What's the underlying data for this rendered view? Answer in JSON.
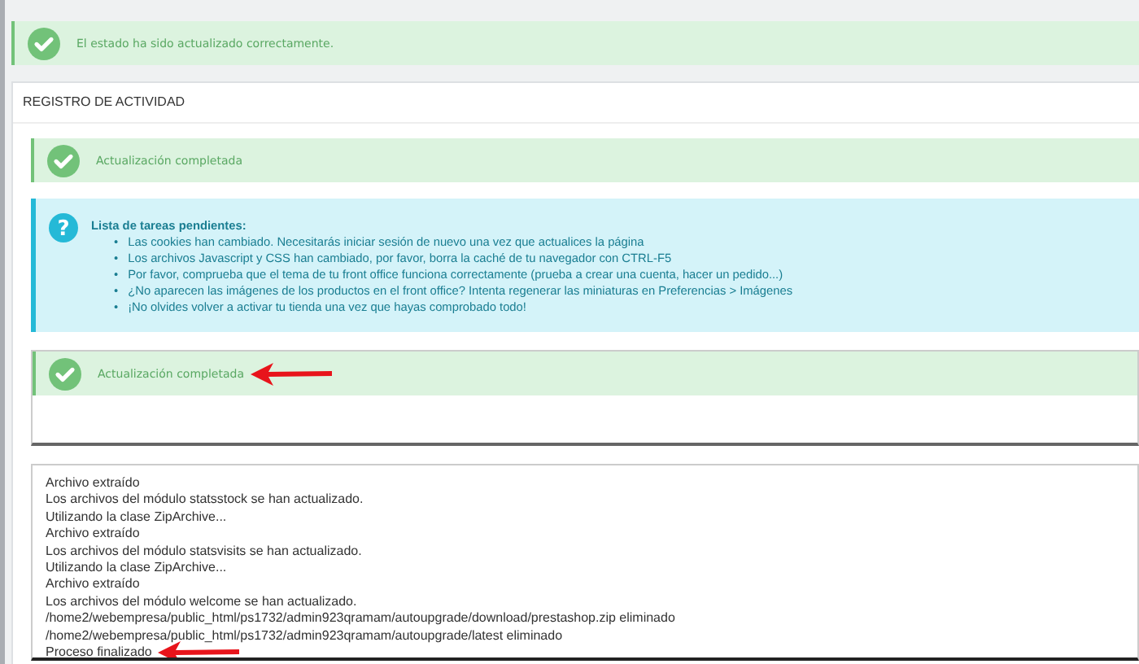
{
  "status_alert": {
    "message": "El estado ha sido actualizado correctamente."
  },
  "panel": {
    "title": "REGISTRO DE ACTIVIDAD",
    "first_alert": {
      "message": "Actualización completada",
      "pointer_arrow": false
    },
    "todo": {
      "icon": "?",
      "title": "Lista de tareas pendientes:",
      "items": [
        {
          "bullet": "•",
          "text": "Las cookies han cambiado. Necesitarás iniciar sesión de nuevo una vez que actualices la página"
        },
        {
          "bullet": "•",
          "text": "Los archivos Javascript y CSS han cambiado, por favor, borra la caché de tu navegador con CTRL-F5"
        },
        {
          "bullet": "•",
          "text": "Por favor, comprueba que el tema de tu front office funciona correctamente (prueba a crear una cuenta, hacer un pedido...)"
        },
        {
          "bullet": "•",
          "text": "¿No aparecen las imágenes de los productos en el front office? Intenta regenerar las miniaturas en Preferencias > Imágenes"
        },
        {
          "bullet": "•",
          "text": "¡No olvides volver a activar tu tienda una vez que hayas comprobado todo!"
        }
      ]
    },
    "second_alert": {
      "message": "Actualización completada",
      "pointer_arrow": true
    },
    "log": [
      {
        "text": "Archivo extraído",
        "pointer_arrow": false
      },
      {
        "text": "Los archivos del módulo statsstock se han actualizado.",
        "pointer_arrow": false
      },
      {
        "text": "Utilizando la clase ZipArchive...",
        "pointer_arrow": false
      },
      {
        "text": "Archivo extraído",
        "pointer_arrow": false
      },
      {
        "text": "Los archivos del módulo statsvisits se han actualizado.",
        "pointer_arrow": false
      },
      {
        "text": "Utilizando la clase ZipArchive...",
        "pointer_arrow": false
      },
      {
        "text": "Archivo extraído",
        "pointer_arrow": false
      },
      {
        "text": "Los archivos del módulo welcome se han actualizado.",
        "pointer_arrow": false
      },
      {
        "text": "/home2/webempresa/public_html/ps1732/admin923qramam/autoupgrade/download/prestashop.zip eliminado",
        "pointer_arrow": false
      },
      {
        "text": "/home2/webempresa/public_html/ps1732/admin923qramam/autoupgrade/latest eliminado",
        "pointer_arrow": false
      },
      {
        "text": "Proceso finalizado",
        "pointer_arrow": true
      }
    ]
  }
}
